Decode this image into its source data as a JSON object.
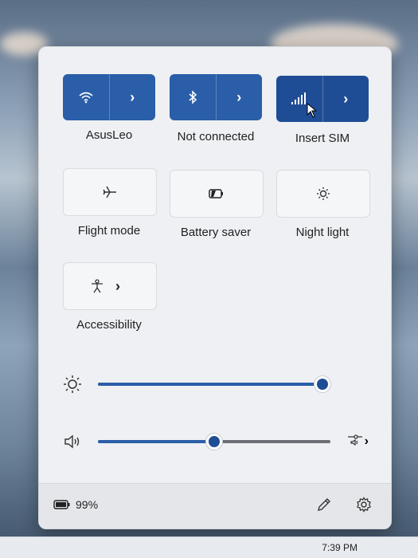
{
  "tiles": {
    "wifi": {
      "label": "AsusLeo",
      "icon": "wifi-icon",
      "state": "on"
    },
    "bluetooth": {
      "label": "Not connected",
      "icon": "bluetooth-icon",
      "state": "on"
    },
    "cellular": {
      "label": "Insert SIM",
      "icon": "cellular-signal-icon",
      "state": "on"
    },
    "flight_mode": {
      "label": "Flight mode",
      "icon": "airplane-icon",
      "state": "off"
    },
    "battery_saver": {
      "label": "Battery saver",
      "icon": "battery-saver-icon",
      "state": "off"
    },
    "night_light": {
      "label": "Night light",
      "icon": "night-light-icon",
      "state": "off"
    },
    "accessibility": {
      "label": "Accessibility",
      "icon": "accessibility-icon",
      "state": "off"
    }
  },
  "brightness": {
    "icon": "brightness-icon",
    "level": 1.0
  },
  "volume": {
    "icon": "speaker-icon",
    "level": 0.5,
    "output_icon": "audio-output-icon"
  },
  "footer": {
    "battery_percent": "99%",
    "edit_icon": "pencil-icon",
    "settings_icon": "gear-icon"
  },
  "taskbar": {
    "time": "7:39 PM"
  },
  "colors": {
    "accent": "#2a5ea8",
    "panel": "#eef0f3"
  }
}
